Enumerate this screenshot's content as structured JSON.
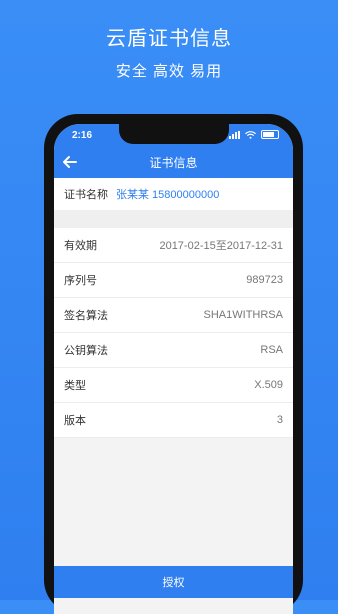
{
  "promo": {
    "title": "云盾证书信息",
    "subtitle": "安全 高效 易用"
  },
  "status_bar": {
    "time": "2:16"
  },
  "header": {
    "back_icon": "arrow-left-icon",
    "title": "证书信息"
  },
  "certificate": {
    "name_label": "证书名称",
    "name_value": "张某某 15800000000"
  },
  "details": [
    {
      "label": "有效期",
      "value": "2017-02-15至2017-12-31"
    },
    {
      "label": "序列号",
      "value": "989723"
    },
    {
      "label": "签名算法",
      "value": "SHA1WITHRSA"
    },
    {
      "label": "公钥算法",
      "value": "RSA"
    },
    {
      "label": "类型",
      "value": "X.509"
    },
    {
      "label": "版本",
      "value": "3"
    }
  ],
  "actions": {
    "authorize_label": "授权"
  },
  "colors": {
    "accent": "#2f7ff0",
    "background": "#3a8ef6"
  }
}
